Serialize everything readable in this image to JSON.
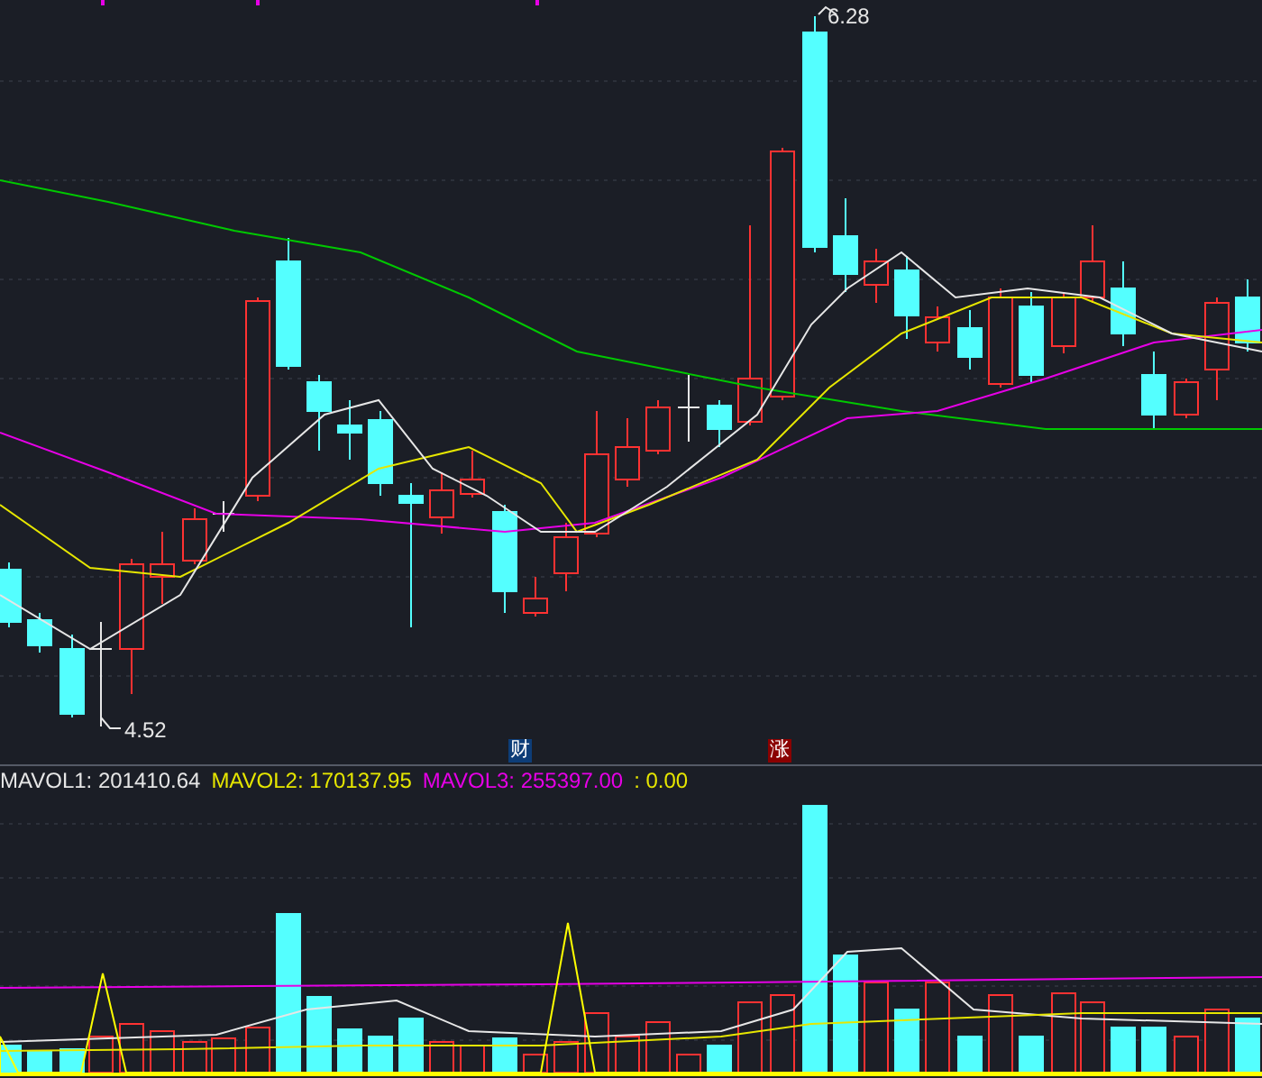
{
  "price_chart": {
    "high_label": "6.28",
    "low_label": "4.52",
    "markers": [
      {
        "kind": "finance",
        "text": "财"
      },
      {
        "kind": "rise",
        "text": "涨"
      }
    ]
  },
  "volume_indicator": {
    "legend": [
      {
        "text": "MAVOL1: 201410.64",
        "color": "#e6e6e6"
      },
      {
        "text": "MAVOL2: 170137.95",
        "color": "#e6e600"
      },
      {
        "text": "MAVOL3: 255397.00",
        "color": "#e600e6"
      },
      {
        "text": ": 0.00",
        "color": "#e6e600"
      }
    ]
  }
}
